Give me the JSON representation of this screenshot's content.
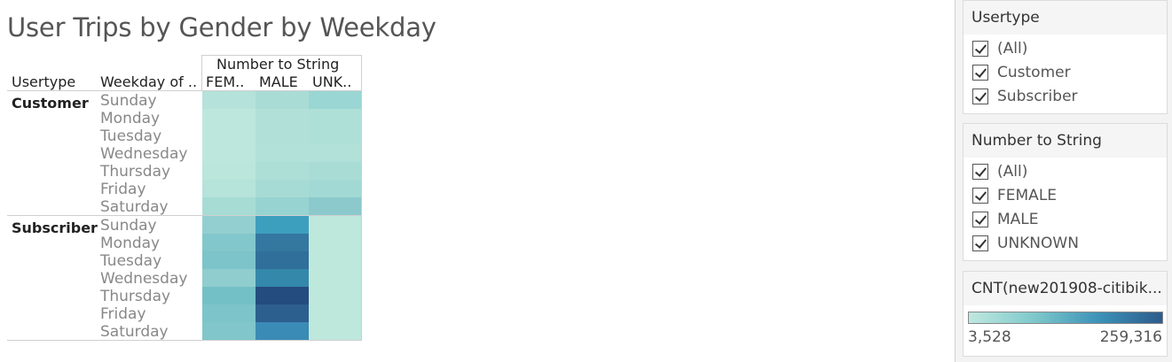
{
  "title": "User Trips by Gender by Weekday",
  "crosstab": {
    "col_group_header": "Number to String",
    "row_headers": [
      "Usertype",
      "Weekday of .."
    ],
    "columns": [
      "FEM..",
      "MALE",
      "UNK.."
    ],
    "groups": [
      {
        "usertype": "Customer",
        "rows": [
          {
            "weekday": "Sunday",
            "colors": [
              "#b5e2da",
              "#aadcd6",
              "#9ad6d3"
            ]
          },
          {
            "weekday": "Monday",
            "colors": [
              "#bde7dd",
              "#b0e0d8",
              "#aee0d8"
            ]
          },
          {
            "weekday": "Tuesday",
            "colors": [
              "#bde7dd",
              "#b0e0d8",
              "#aee0d8"
            ]
          },
          {
            "weekday": "Wednesday",
            "colors": [
              "#bde7dd",
              "#b2e1d9",
              "#b2e1d9"
            ]
          },
          {
            "weekday": "Thursday",
            "colors": [
              "#bbe6dc",
              "#aedfd7",
              "#aadcd6"
            ]
          },
          {
            "weekday": "Friday",
            "colors": [
              "#b6e3da",
              "#a6dbd5",
              "#a2d9d4"
            ]
          },
          {
            "weekday": "Saturday",
            "colors": [
              "#a7dcd5",
              "#97d3d1",
              "#8bc9cc"
            ]
          }
        ]
      },
      {
        "usertype": "Subscriber",
        "rows": [
          {
            "weekday": "Sunday",
            "colors": [
              "#93cfd0",
              "#3d9fbe",
              "#bfe8dd"
            ]
          },
          {
            "weekday": "Monday",
            "colors": [
              "#82c7cb",
              "#35789f",
              "#bfe8dd"
            ]
          },
          {
            "weekday": "Tuesday",
            "colors": [
              "#7cc4c9",
              "#2f6f9a",
              "#bfe8dd"
            ]
          },
          {
            "weekday": "Wednesday",
            "colors": [
              "#8fcdce",
              "#3488aa",
              "#bfe8dd"
            ]
          },
          {
            "weekday": "Thursday",
            "colors": [
              "#74c0c7",
              "#254c7f",
              "#bfe8dd"
            ]
          },
          {
            "weekday": "Friday",
            "colors": [
              "#7cc4c9",
              "#2c5f8e",
              "#bfe8dd"
            ]
          },
          {
            "weekday": "Saturday",
            "colors": [
              "#80c6ca",
              "#3a8bb5",
              "#bfe8dd"
            ]
          }
        ]
      }
    ]
  },
  "filters": [
    {
      "title": "Usertype",
      "options": [
        "(All)",
        "Customer",
        "Subscriber"
      ]
    },
    {
      "title": "Number to String",
      "options": [
        "(All)",
        "FEMALE",
        "MALE",
        "UNKNOWN"
      ]
    }
  ],
  "legend": {
    "title": "CNT(new201908-citibik...",
    "min": "3,528",
    "max": "259,316",
    "colors": [
      "#bfe8df",
      "#2d5b8c"
    ]
  }
}
